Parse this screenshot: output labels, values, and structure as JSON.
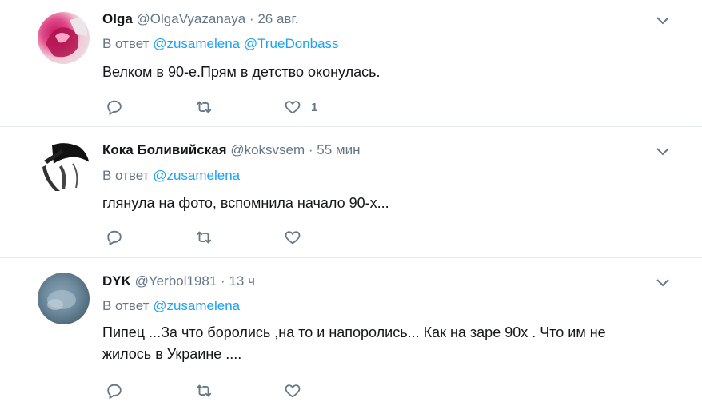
{
  "tweets": [
    {
      "name": "Olga",
      "handle": "@OlgaVyazanaya",
      "dot": "·",
      "time": "26 авг.",
      "reply_prefix": "В ответ",
      "reply_to": [
        "@zusamelena",
        "@TrueDonbass"
      ],
      "text": "Велком в 90-е.Прям в детство оконулась.",
      "like_count": "1"
    },
    {
      "name": "Кока Боливийская",
      "handle": "@koksvsem",
      "dot": "·",
      "time": "55 мин",
      "reply_prefix": "В ответ",
      "reply_to": [
        "@zusamelena"
      ],
      "text": "глянула на фото, вспомнила начало 90-х..."
    },
    {
      "name": "DYK",
      "handle": "@Yerbol1981",
      "dot": "·",
      "time": "13 ч",
      "reply_prefix": "В ответ",
      "reply_to": [
        "@zusamelena"
      ],
      "text": "Пипец ...За что боролись ,на то и напоролись... Как на заре 90х . Что им не жилось в Украине ...."
    }
  ],
  "icons": {
    "reply": "reply-icon",
    "retweet": "retweet-icon",
    "like": "heart-icon",
    "more": "chevron-down-icon"
  },
  "colors": {
    "text": "#14171a",
    "secondary": "#657786",
    "link": "#1da1f2",
    "divider": "#e6ecf0"
  }
}
